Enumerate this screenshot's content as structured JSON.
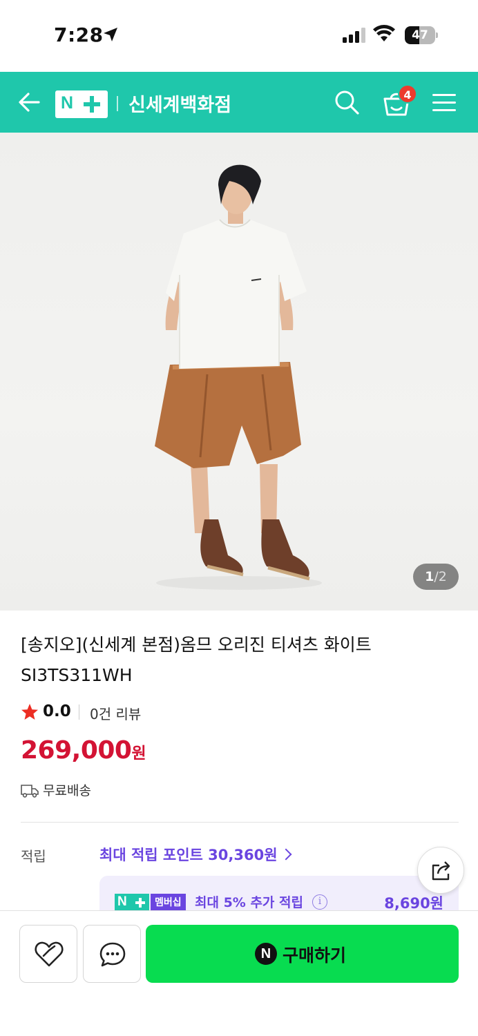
{
  "status_bar": {
    "time": "7:28",
    "battery_percent": "47",
    "battery_level": 0.47
  },
  "header": {
    "store_name": "신세계백화점",
    "cart_count": "4",
    "brand_color": "#1fc7ab"
  },
  "gallery": {
    "current": "1",
    "separator": "/",
    "total": "2"
  },
  "product": {
    "title": "[송지오](신세계 본점)옴므 오리진 티셔츠 화이트 SI3TS311WH",
    "rating": "0.0",
    "review_count": "0건 리뷰",
    "price": "269,000",
    "price_unit": "원",
    "price_color": "#d31334",
    "shipping": "무료배송"
  },
  "points": {
    "label": "적립",
    "max_points": "최대 적립 포인트 30,360원",
    "membership_tag": "멤버십",
    "membership_text": "최대 5% 추가 적립",
    "membership_amount": "8,690원",
    "accent_color": "#6a45e0"
  },
  "bottom_bar": {
    "buy_label": "구매하기",
    "buy_color": "#08dc50"
  }
}
